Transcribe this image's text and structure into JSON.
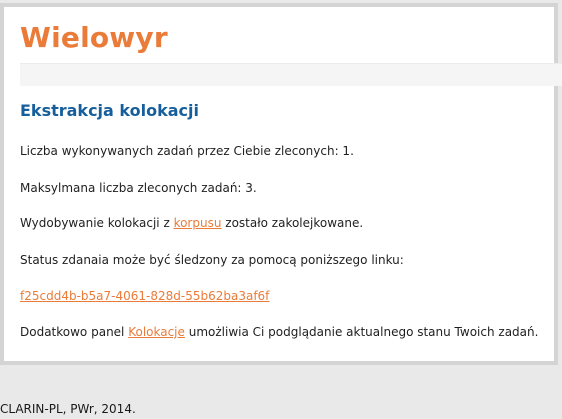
{
  "header": {
    "brand": "Wielowyr"
  },
  "section": {
    "title": "Ekstrakcja kolokacji"
  },
  "content": {
    "tasks_count_text": "Liczba wykonywanych zadań przez Ciebie zleconych: 1.",
    "max_tasks_text": "Maksylmana liczba zleconych zadań: 3.",
    "queued_prefix": "Wydobywanie kolokacji z ",
    "corpus_link": "korpusu",
    "queued_suffix": " zostało zakolejkowane.",
    "status_text": "Status zdanaia może być śledzony za pomocą poniższego linku:",
    "task_link": "f25cdd4b-b5a7-4061-828d-55b62ba3af6f",
    "panel_prefix": "Dodatkowo panel ",
    "panel_link": "Kolokacje",
    "panel_suffix": " umożliwia Ci podglądanie aktualnego stanu Twoich zadań."
  },
  "footer": {
    "text": "CLARIN-PL, PWr, 2014."
  },
  "colors": {
    "brand": "#ea7b39",
    "section_title": "#175f9c",
    "link": "#ea7b39",
    "background": "#e9e9e9"
  }
}
